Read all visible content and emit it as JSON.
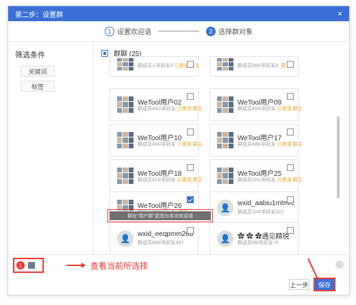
{
  "dialog": {
    "title": "第二步：设置群",
    "close": "×"
  },
  "steps": [
    {
      "num": "1",
      "label": "设置欢迎语"
    },
    {
      "num": "2",
      "label": "选择群对象"
    }
  ],
  "filter": {
    "header": "筛选条件",
    "buttons": [
      "关键词",
      "标签"
    ]
  },
  "group": {
    "label": "群聊 (25)"
  },
  "cards": [
    {
      "name": "",
      "sub": "群成员1/非好友0",
      "tag1": "已邀请",
      "tag2": "群主",
      "checked": false
    },
    {
      "name": "",
      "sub": "群成员500/非好友0",
      "tag1": "",
      "tag2": "群主",
      "checked": false
    },
    {
      "name": "WeTool用户02",
      "sub": "群成员492/非好友",
      "tag1": "已邀请",
      "tag2": "群主",
      "checked": false
    },
    {
      "name": "WeTool用户09",
      "sub": "群成员489/非好友",
      "tag1": "已邀请",
      "tag2": "群主",
      "checked": false
    },
    {
      "name": "WeTool用户10",
      "sub": "群成员486/非好友",
      "tag1": "已邀请",
      "tag2": "群主",
      "checked": false
    },
    {
      "name": "WeTool用户17",
      "sub": "群成员488/非好友",
      "tag1": "已邀请",
      "tag2": "群主",
      "checked": false
    },
    {
      "name": "WeTool用户18",
      "sub": "群成员423/非好友",
      "tag1": "已邀请",
      "tag2": "群主",
      "checked": false
    },
    {
      "name": "WeTool用户25",
      "sub": "群成员201/非好友",
      "tag1": "已邀请",
      "tag2": "群主",
      "checked": false
    },
    {
      "name": "WeTool用户26",
      "sub": "群成员160/非好友",
      "tag1": "",
      "tag2": "群主",
      "checked": true
    },
    {
      "name": "wxid_aabiu1mtmrc",
      "sub": "群成员324/非好友322",
      "tag1": "",
      "tag2": "",
      "checked": false
    },
    {
      "name": "wxid_eeqpmm26d",
      "sub": "群成员469/非好友467",
      "tag1": "",
      "tag2": "",
      "checked": false
    },
    {
      "name": "✿ ✿ ✿遇见精锐",
      "sub": "群成员88/非好友76",
      "tag1": "",
      "tag2": "",
      "checked": false
    }
  ],
  "tooltip": "群在\"用户群\"更改为本次欢迎语",
  "footer": {
    "badge": "1",
    "hint": "查看当前所选择",
    "prev": "上一步",
    "save": "保存"
  }
}
